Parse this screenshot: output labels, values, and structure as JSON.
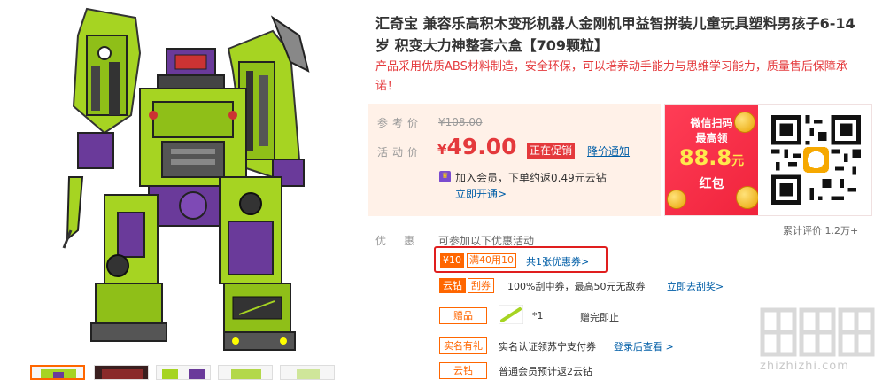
{
  "product": {
    "title": "汇奇宝 兼容乐高积木变形机器人金刚机甲益智拼装儿童玩具塑料男孩子6-14岁 积变大力神整套六盒【709颗粒】",
    "promo_text": "产品采用优质ABS材料制造，安全环保，可以培养动手能力与思维学习能力，质量售后保障承诺！"
  },
  "price": {
    "ref_label": "参考价",
    "ref_value": "¥108.00",
    "act_label": "活动价",
    "currency": "¥",
    "act_value": "49.00",
    "sale_tag": "正在促销",
    "notify_link": "降价通知",
    "member_icon": "crown-icon",
    "member_text": "加入会员，下单约返0.49元云钻",
    "member_link": "立即开通>"
  },
  "redpacket": {
    "line1": "微信扫码",
    "line2": "最高领",
    "amount": "88.8",
    "unit": "元",
    "line3": "红包"
  },
  "review": "累计评价 1.2万+",
  "offers": {
    "label": "优惠",
    "available": "可参加以下优惠活动",
    "coupon_value": "¥10",
    "coupon_condition": "满40用10",
    "coupon_link": "共1张优惠券>",
    "scratch_tag1": "云钻",
    "scratch_tag2": "刮券",
    "scratch_text": "100%刮中券，最高50元无敌券",
    "scratch_link": "立即去刮奖>",
    "gift_tag": "赠品",
    "gift_qty": "*1",
    "gift_status": "赠完即止",
    "realname_tag": "实名有礼",
    "realname_text": "实名认证领苏宁支付券",
    "realname_link": "登录后查看 >",
    "yun_tag": "云钻",
    "yun_text": "普通会员预计返2云钻"
  },
  "watermark": "zhizhizhi.com",
  "colors": {
    "accent": "#e4393c",
    "orange": "#ff6600",
    "link": "#005ea7",
    "robot_green": "#a6d422",
    "robot_purple": "#6a3a9a"
  }
}
